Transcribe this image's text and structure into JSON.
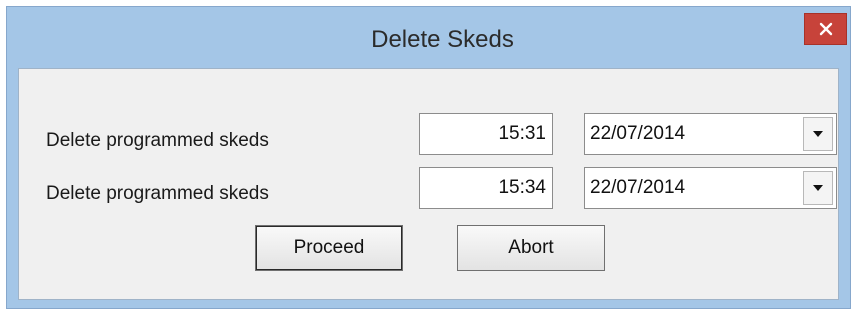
{
  "window": {
    "title": "Delete Skeds"
  },
  "rows": [
    {
      "label": "Delete programmed skeds",
      "time": "15:31",
      "date": "22/07/2014"
    },
    {
      "label": "Delete programmed skeds",
      "time": "15:34",
      "date": "22/07/2014"
    }
  ],
  "buttons": {
    "proceed": "Proceed",
    "abort": "Abort"
  },
  "icons": {
    "close": "close-icon",
    "dropdown": "chevron-down-icon"
  },
  "colors": {
    "titlebar": "#a4c6e7",
    "close": "#c7433a",
    "client": "#f0f0f0"
  }
}
